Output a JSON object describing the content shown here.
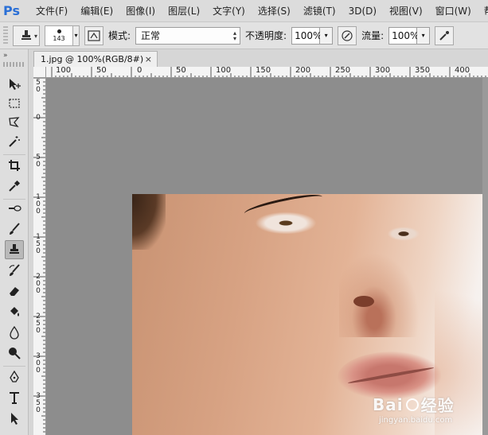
{
  "app": {
    "logo": "Ps"
  },
  "menu": [
    "文件(F)",
    "编辑(E)",
    "图像(I)",
    "图层(L)",
    "文字(Y)",
    "选择(S)",
    "滤镜(T)",
    "3D(D)",
    "视图(V)",
    "窗口(W)",
    "帮助"
  ],
  "options": {
    "brush_size": "143",
    "mode_label": "模式:",
    "mode_value": "正常",
    "opacity_label": "不透明度:",
    "opacity_value": "100%",
    "flow_label": "流量:",
    "flow_value": "100%"
  },
  "toolbox": {
    "header": "»"
  },
  "document": {
    "tab_title": "1.jpg @ 100%(RGB/8#)",
    "close_symbol": "×"
  },
  "ruler_top": [
    "100",
    "50",
    "0",
    "50",
    "100",
    "150",
    "200",
    "250",
    "300",
    "350",
    "400"
  ],
  "ruler_left": [
    "5\n0",
    "0",
    "5\n0",
    "1\n0\n0",
    "1\n5\n0",
    "2\n0\n0",
    "2\n5\n0",
    "3\n0\n0",
    "3\n5\n0",
    "4\n0\n0"
  ],
  "watermark": {
    "main_left": "Bai",
    "main_right": "经验",
    "sub": "jingyan.baidu.com"
  }
}
